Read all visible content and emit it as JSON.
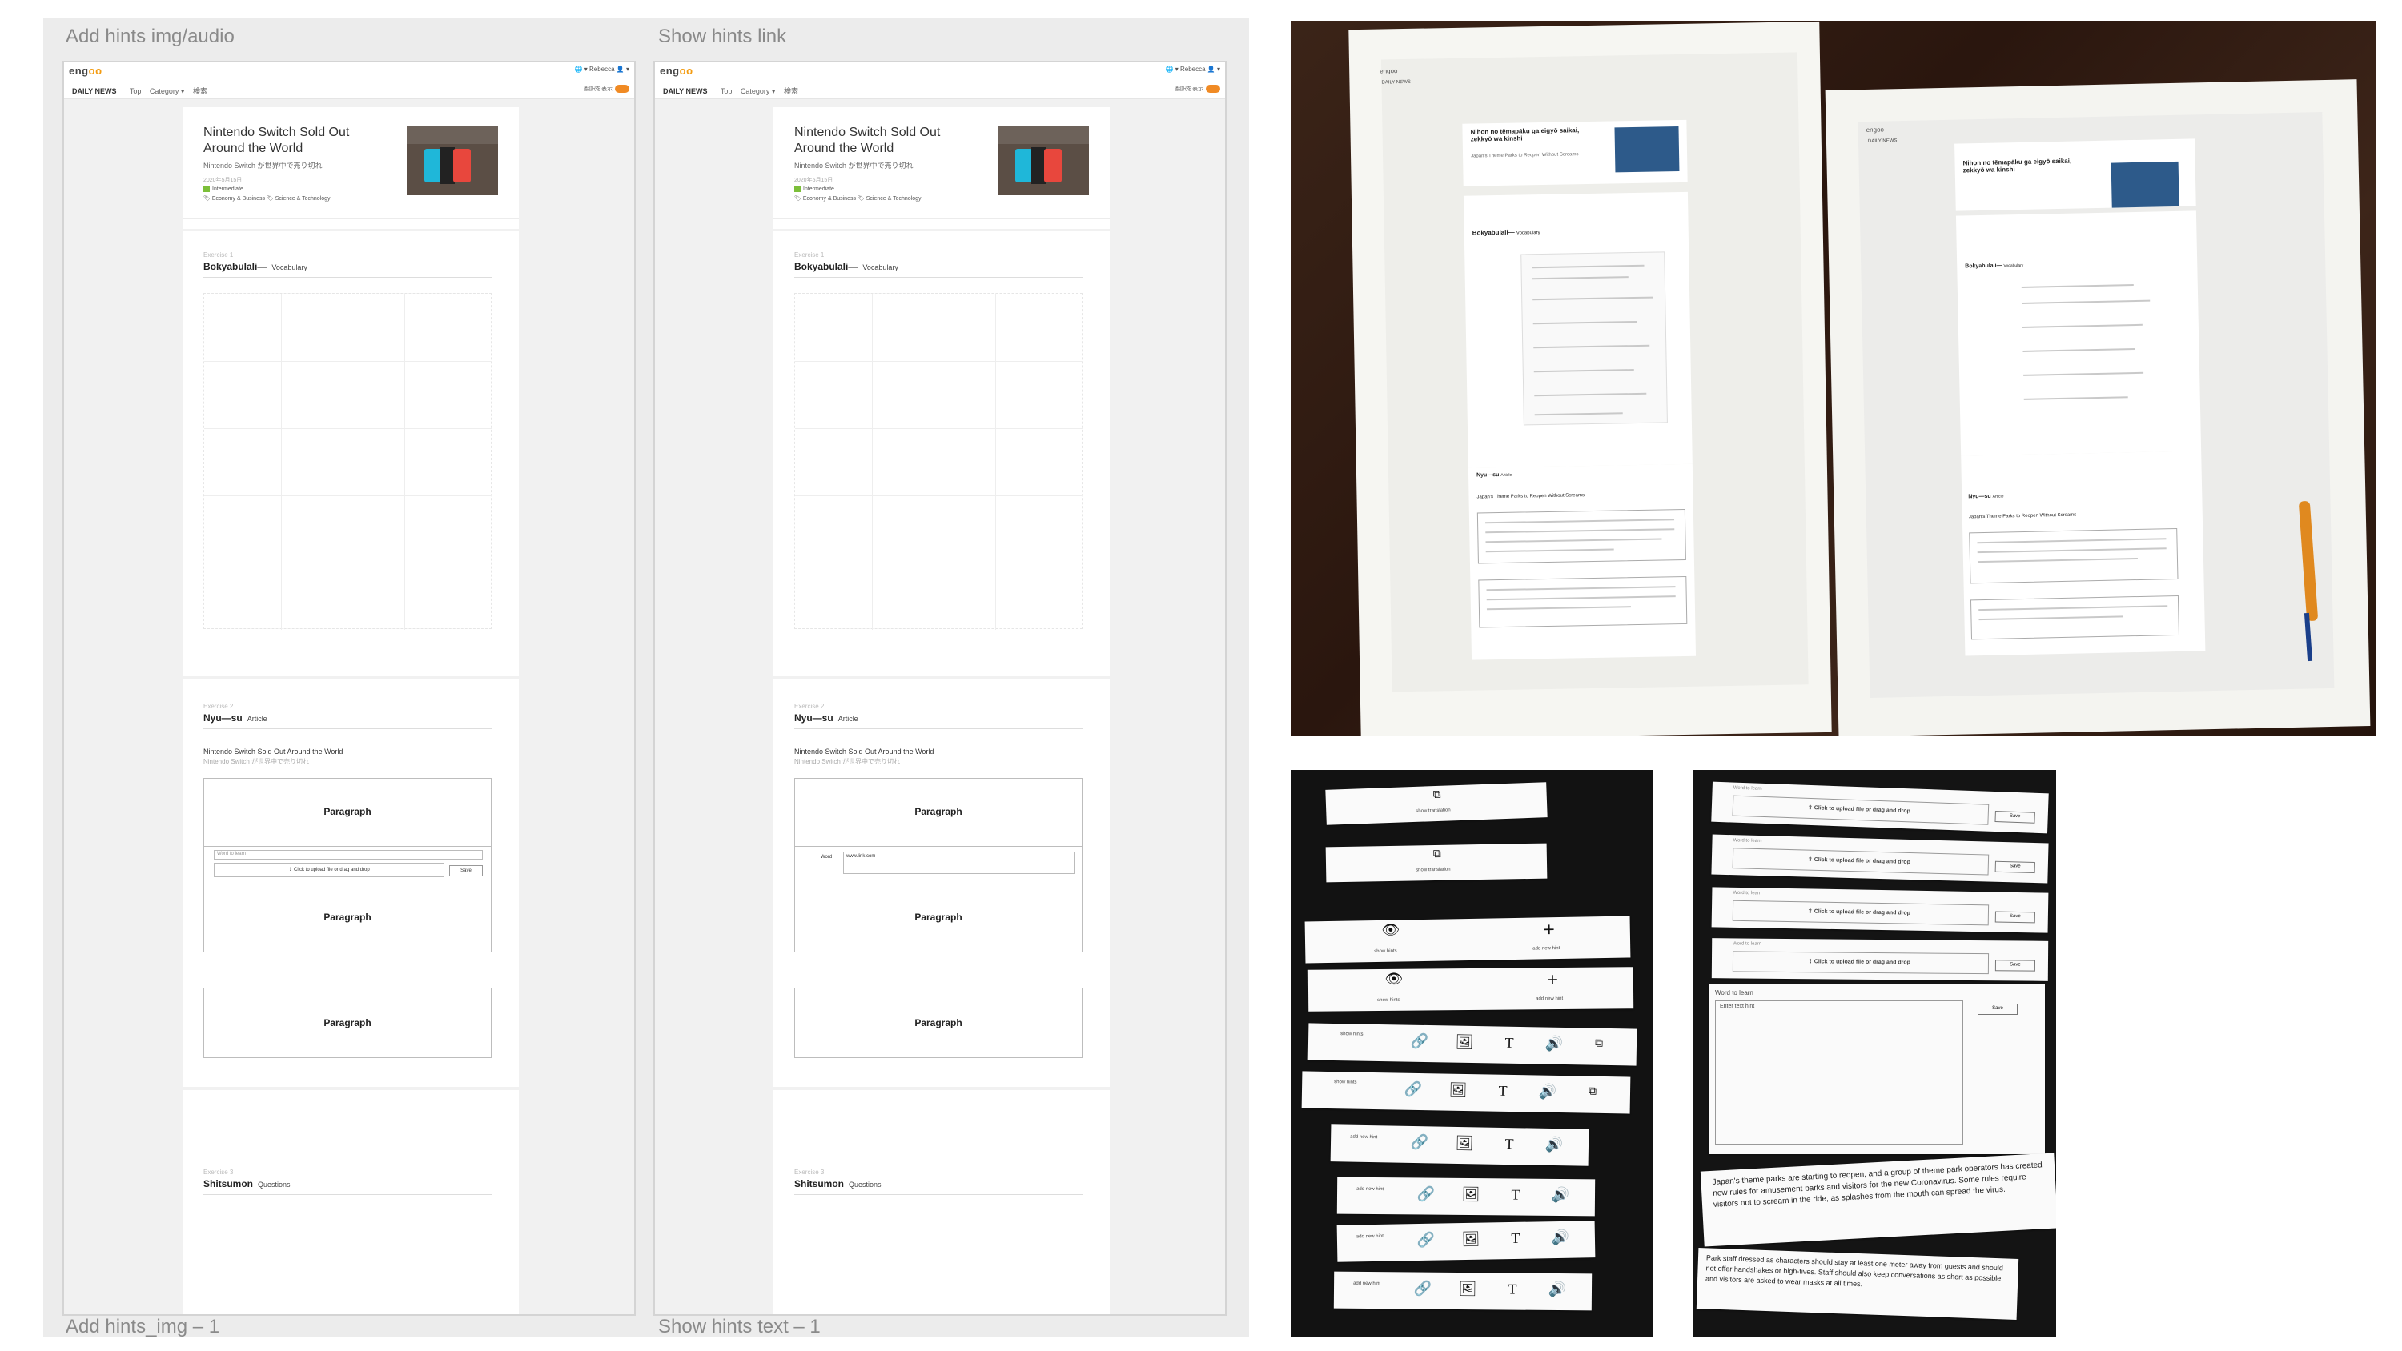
{
  "frames": [
    {
      "title": "Add hints img/audio",
      "footer": "Add hints_img – 1",
      "variant": "upload"
    },
    {
      "title": "Show hints link",
      "footer": "Show hints text – 1",
      "variant": "link"
    }
  ],
  "site": {
    "logo_prefix": "eng",
    "logo_suffix": "oo",
    "topright": "🌐 ▾   Rebecca  👤 ▾",
    "nav_brand": "DAILY NEWS",
    "nav_items": [
      "Top",
      "Category ▾",
      "検索"
    ],
    "toggle_label": "翻訳を表示"
  },
  "article": {
    "title": "Nintendo Switch Sold Out Around the World",
    "subtitle": "Nintendo Switch が世界中で売り切れ",
    "date": "2020年5月15日",
    "level": "Intermediate",
    "tags": "🏷 Economy & Business  🏷 Science & Technology"
  },
  "exercises": {
    "ex1_label": "Exercise 1",
    "ex1_title": "Bokyabulali—",
    "ex1_sub": "Vocabulary",
    "ex2_label": "Exercise 2",
    "ex2_title": "Nyu—su",
    "ex2_sub": "Article",
    "ex2_headline": "Nintendo Switch Sold Out Around the World",
    "ex2_headline_jp": "Nintendo Switch が世界中で売り切れ",
    "paragraph": "Paragraph",
    "word_placeholder": "Word to learn",
    "upload_text": "Click to upload file or drag and drop",
    "save": "Save",
    "word_label": "Word",
    "link_value": "www.link.com",
    "ex3_label": "Exercise 3",
    "ex3_title": "Shitsumon",
    "ex3_sub": "Questions"
  },
  "photo_papers": {
    "left_title": "Nihon no tēmapāku ga eigyō saikai, zekkyō wa kinshi",
    "left_sub": "Japan's Theme Parks to Reopen Without Screams",
    "vocab_head": "Bokyabulali—",
    "vocab_sub": "Vocabulary",
    "news_head": "Nyu—su",
    "news_sub": "Article",
    "news_title": "Japan's Theme Parks to Reopen Without Screams",
    "daily": "DAILY NEWS"
  },
  "strips": {
    "show_translation": "show translation",
    "show_hints": "show hints",
    "add_new_hint": "add new hint",
    "click_upload": "Click to upload file or drag and drop",
    "save": "Save",
    "word_to_learn": "Word to learn",
    "enter_text_hint": "Enter text hint",
    "para1": "Japan's theme parks are starting to reopen, and a group of theme park operators has created new rules for amusement parks and visitors for the new Coronavirus. Some rules require visitors not to scream in the ride, as splashes from the mouth can spread the virus.",
    "para2": "Park staff dressed as characters should stay at least one meter away from guests and should not offer handshakes or high-fives. Staff should also keep conversations as short as possible and visitors are asked to wear masks at all times."
  }
}
